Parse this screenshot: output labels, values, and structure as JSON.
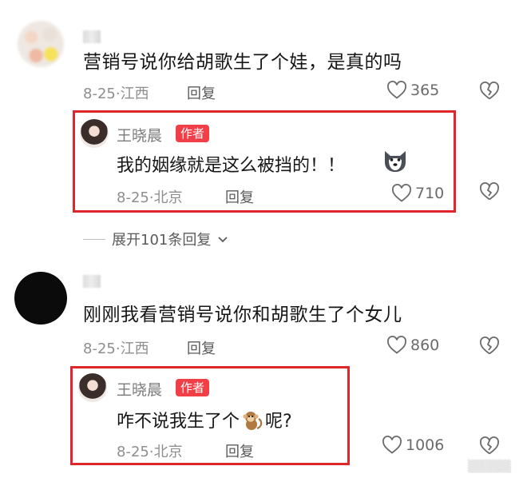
{
  "comments": [
    {
      "text": "营销号说你给胡歌生了个娃，是真的吗",
      "date": "8-25",
      "location": "江西",
      "reply_label": "回复",
      "likes": "365",
      "author_reply": {
        "name": "王晓晨",
        "badge": "作者",
        "text": "我的姻缘就是这么被挡的！！",
        "emoji_icon": "husky-dog-face-icon",
        "date": "8-25",
        "location": "北京",
        "reply_label": "回复",
        "likes": "710"
      }
    },
    {
      "text": "刚刚我看营销号说你和胡歌生了个女儿",
      "date": "8-25",
      "location": "江西",
      "reply_label": "回复",
      "likes": "860",
      "author_reply": {
        "name": "王晓晨",
        "badge": "作者",
        "text_before": "咋不说我生了个",
        "emoji_icon": "monkey-icon",
        "text_after": "呢?",
        "date": "8-25",
        "location": "北京",
        "reply_label": "回复",
        "likes": "1006"
      }
    }
  ],
  "expand_replies": {
    "label": "展开101条回复"
  },
  "colors": {
    "highlight_border": "#e0252b",
    "badge_bg": "#f03f46"
  }
}
